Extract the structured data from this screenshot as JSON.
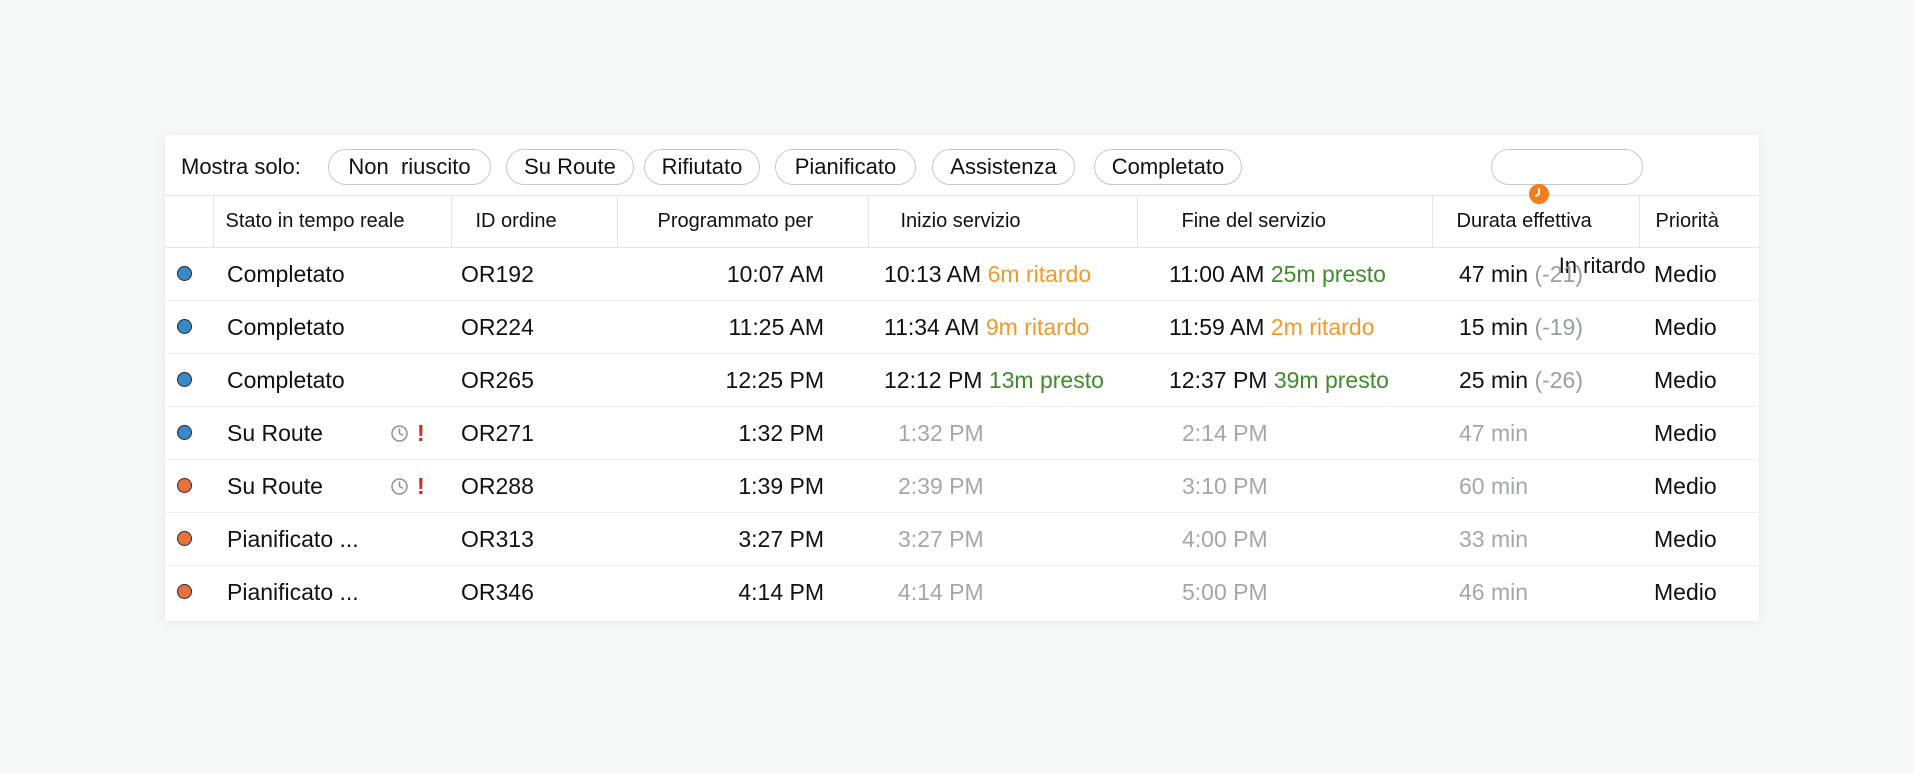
{
  "filters": {
    "label": "Mostra solo:",
    "chips": [
      "Non  riuscito",
      "Su Route",
      "Rifiutato",
      "Pianificato",
      "Assistenza",
      "Completato"
    ],
    "late_chip": "In ritardo"
  },
  "colors": {
    "dot_blue": "#3b88c8",
    "dot_orange": "#e8713c",
    "late": "#f29a2e",
    "early": "#3f8b2c",
    "alert": "#e02424"
  },
  "table": {
    "headers": [
      "",
      "Stato in tempo reale",
      "ID ordine",
      "Programmato per",
      "Inizio servizio",
      "Fine del servizio",
      "Durata effettiva",
      "Priorità"
    ],
    "rows": [
      {
        "dot": "blue",
        "status": "Completato",
        "icons": false,
        "id": "OR192",
        "scheduled": "10:07 AM",
        "start": "10:13 AM",
        "start_delta": "6m ritardo",
        "start_kind": "late",
        "end": "11:00 AM",
        "end_delta": "25m presto",
        "end_kind": "early",
        "duration": "47 min",
        "diff": "(-21)",
        "priority": "Medio",
        "projected": false
      },
      {
        "dot": "blue",
        "status": "Completato",
        "icons": false,
        "id": "OR224",
        "scheduled": "11:25 AM",
        "start": "11:34 AM",
        "start_delta": "9m ritardo",
        "start_kind": "late",
        "end": "11:59 AM",
        "end_delta": "2m ritardo",
        "end_kind": "late",
        "duration": "15 min",
        "diff": "(-19)",
        "priority": "Medio",
        "projected": false
      },
      {
        "dot": "blue",
        "status": "Completato",
        "icons": false,
        "id": "OR265",
        "scheduled": "12:25 PM",
        "start": "12:12 PM",
        "start_delta": "13m presto",
        "start_kind": "early",
        "end": "12:37 PM",
        "end_delta": "39m presto",
        "end_kind": "early",
        "duration": "25 min",
        "diff": "(-26)",
        "priority": "Medio",
        "projected": false
      },
      {
        "dot": "blue",
        "status": "Su Route",
        "icons": true,
        "id": "OR271",
        "scheduled": "1:32 PM",
        "start": "1:32 PM",
        "start_delta": "",
        "start_kind": "",
        "end": "2:14 PM",
        "end_delta": "",
        "end_kind": "",
        "duration": "47 min",
        "diff": "",
        "priority": "Medio",
        "projected": true
      },
      {
        "dot": "orange",
        "status": "Su Route",
        "icons": true,
        "id": "OR288",
        "scheduled": "1:39 PM",
        "start": "2:39 PM",
        "start_delta": "",
        "start_kind": "",
        "end": "3:10 PM",
        "end_delta": "",
        "end_kind": "",
        "duration": "60 min",
        "diff": "",
        "priority": "Medio",
        "projected": true
      },
      {
        "dot": "orange",
        "status": "Pianificato ...",
        "icons": false,
        "id": "OR313",
        "scheduled": "3:27 PM",
        "start": "3:27 PM",
        "start_delta": "",
        "start_kind": "",
        "end": "4:00 PM",
        "end_delta": "",
        "end_kind": "",
        "duration": "33 min",
        "diff": "",
        "priority": "Medio",
        "projected": true
      },
      {
        "dot": "orange",
        "status": "Pianificato ...",
        "icons": false,
        "id": "OR346",
        "scheduled": "4:14 PM",
        "start": "4:14 PM",
        "start_delta": "",
        "start_kind": "",
        "end": "5:00 PM",
        "end_delta": "",
        "end_kind": "",
        "duration": "46 min",
        "diff": "",
        "priority": "Medio",
        "projected": true
      }
    ]
  }
}
